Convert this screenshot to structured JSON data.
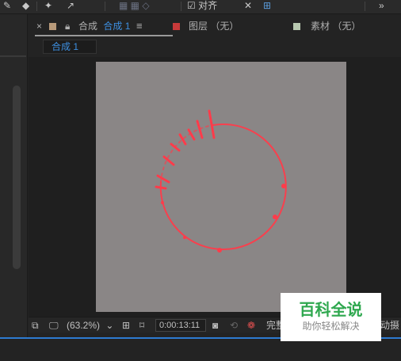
{
  "toolbar": {
    "snap_label": "对齐"
  },
  "tabs": {
    "comp_prefix": "合成",
    "comp_name": "合成 1",
    "comp_menu_icon": "hamburger-menu-icon",
    "layer_label": "图层 （无）",
    "footage_label": "素材 （无）",
    "comp_color": "#b89a7a",
    "layer_color": "#c83a3a",
    "footage_color": "#b8c8b0"
  },
  "viewer": {
    "breadcrumb_tab": "合成 1",
    "canvas_color": "#8a8686",
    "stroke_color": "#ff3b4a"
  },
  "bottom_bar": {
    "zoom": "(63.2%)",
    "timecode": "0:00:13:11",
    "resolution": "完整",
    "camera_label": "动摄"
  },
  "watermark": {
    "title": "百科全说",
    "subtitle": "助你轻松解决"
  }
}
